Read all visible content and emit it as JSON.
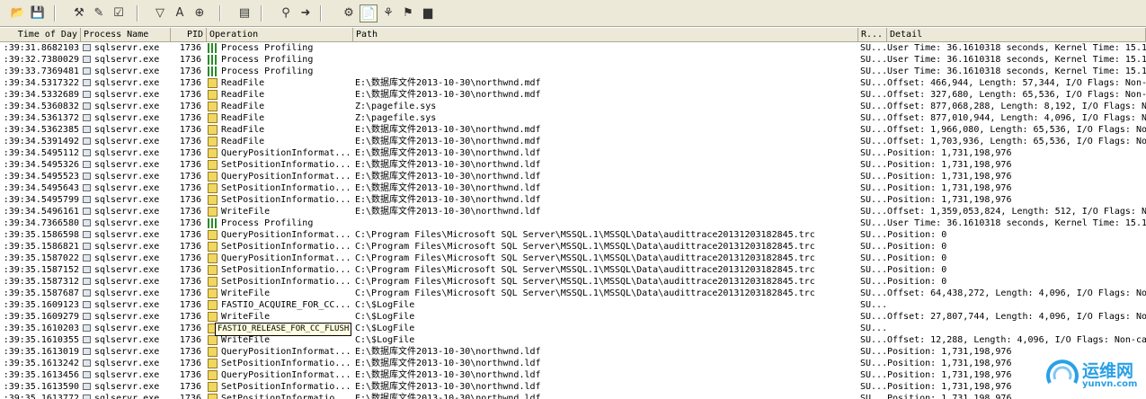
{
  "toolbar": {
    "buttons": [
      {
        "name": "open-icon",
        "glyph": "📂"
      },
      {
        "name": "save-icon",
        "glyph": "💾"
      },
      {
        "name": "autoscroll-icon",
        "glyph": "⚒"
      },
      {
        "name": "clear-icon",
        "glyph": "✎"
      },
      {
        "name": "capture-icon",
        "glyph": "☑"
      },
      {
        "name": "filter-icon",
        "glyph": "▽"
      },
      {
        "name": "highlight-icon",
        "glyph": "A"
      },
      {
        "name": "target-icon",
        "glyph": "⊕"
      },
      {
        "name": "process-tree-icon",
        "glyph": "▤"
      },
      {
        "name": "find-icon",
        "glyph": "⚲"
      },
      {
        "name": "jump-icon",
        "glyph": "➜"
      },
      {
        "name": "registry-activity-icon",
        "glyph": "⚙"
      },
      {
        "name": "file-activity-icon",
        "glyph": "📄"
      },
      {
        "name": "network-activity-icon",
        "glyph": "⚘"
      },
      {
        "name": "process-activity-icon",
        "glyph": "⚑"
      },
      {
        "name": "profiling-activity-icon",
        "glyph": "▆"
      }
    ]
  },
  "columns": {
    "time": "Time of Day",
    "process": "Process Name",
    "pid": "PID",
    "operation": "Operation",
    "path": "Path",
    "result": "R...",
    "detail": "Detail"
  },
  "rows": [
    {
      "time": ":39:31.8682103",
      "process": "sqlservr.exe",
      "pid": "1736",
      "op": "Process Profiling",
      "path": "",
      "result": "SU...",
      "detail": "User Time: 36.1610318 seconds, Kernel Time: 15.1",
      "icon": "prof"
    },
    {
      "time": ":39:32.7380029",
      "process": "sqlservr.exe",
      "pid": "1736",
      "op": "Process Profiling",
      "path": "",
      "result": "SU...",
      "detail": "User Time: 36.1610318 seconds, Kernel Time: 15.1",
      "icon": "prof"
    },
    {
      "time": ":39:33.7369481",
      "process": "sqlservr.exe",
      "pid": "1736",
      "op": "Process Profiling",
      "path": "",
      "result": "SU...",
      "detail": "User Time: 36.1610318 seconds, Kernel Time: 15.1",
      "icon": "prof"
    },
    {
      "time": ":39:34.5317322",
      "process": "sqlservr.exe",
      "pid": "1736",
      "op": "ReadFile",
      "path": "E:\\数据库文件2013-10-30\\northwnd.mdf",
      "result": "SU...",
      "detail": "Offset: 466,944, Length: 57,344, I/O Flags: Non-",
      "icon": "file"
    },
    {
      "time": ":39:34.5332689",
      "process": "sqlservr.exe",
      "pid": "1736",
      "op": "ReadFile",
      "path": "E:\\数据库文件2013-10-30\\northwnd.mdf",
      "result": "SU...",
      "detail": "Offset: 327,680, Length: 65,536, I/O Flags: Non-",
      "icon": "file"
    },
    {
      "time": ":39:34.5360832",
      "process": "sqlservr.exe",
      "pid": "1736",
      "op": "ReadFile",
      "path": "Z:\\pagefile.sys",
      "result": "SU...",
      "detail": "Offset: 877,068,288, Length: 8,192, I/O Flags: N",
      "icon": "file"
    },
    {
      "time": ":39:34.5361372",
      "process": "sqlservr.exe",
      "pid": "1736",
      "op": "ReadFile",
      "path": "Z:\\pagefile.sys",
      "result": "SU...",
      "detail": "Offset: 877,010,944, Length: 4,096, I/O Flags: N",
      "icon": "file"
    },
    {
      "time": ":39:34.5362385",
      "process": "sqlservr.exe",
      "pid": "1736",
      "op": "ReadFile",
      "path": "E:\\数据库文件2013-10-30\\northwnd.mdf",
      "result": "SU...",
      "detail": "Offset: 1,966,080, Length: 65,536, I/O Flags: No",
      "icon": "file"
    },
    {
      "time": ":39:34.5391492",
      "process": "sqlservr.exe",
      "pid": "1736",
      "op": "ReadFile",
      "path": "E:\\数据库文件2013-10-30\\northwnd.mdf",
      "result": "SU...",
      "detail": "Offset: 1,703,936, Length: 65,536, I/O Flags: No",
      "icon": "file"
    },
    {
      "time": ":39:34.5495112",
      "process": "sqlservr.exe",
      "pid": "1736",
      "op": "QueryPositionInformat...",
      "path": "E:\\数据库文件2013-10-30\\northwnd.ldf",
      "result": "SU...",
      "detail": "Position: 1,731,198,976",
      "icon": "file"
    },
    {
      "time": ":39:34.5495326",
      "process": "sqlservr.exe",
      "pid": "1736",
      "op": "SetPositionInformatio...",
      "path": "E:\\数据库文件2013-10-30\\northwnd.ldf",
      "result": "SU...",
      "detail": "Position: 1,731,198,976",
      "icon": "file"
    },
    {
      "time": ":39:34.5495523",
      "process": "sqlservr.exe",
      "pid": "1736",
      "op": "QueryPositionInformat...",
      "path": "E:\\数据库文件2013-10-30\\northwnd.ldf",
      "result": "SU...",
      "detail": "Position: 1,731,198,976",
      "icon": "file"
    },
    {
      "time": ":39:34.5495643",
      "process": "sqlservr.exe",
      "pid": "1736",
      "op": "SetPositionInformatio...",
      "path": "E:\\数据库文件2013-10-30\\northwnd.ldf",
      "result": "SU...",
      "detail": "Position: 1,731,198,976",
      "icon": "file"
    },
    {
      "time": ":39:34.5495799",
      "process": "sqlservr.exe",
      "pid": "1736",
      "op": "SetPositionInformatio...",
      "path": "E:\\数据库文件2013-10-30\\northwnd.ldf",
      "result": "SU...",
      "detail": "Position: 1,731,198,976",
      "icon": "file"
    },
    {
      "time": ":39:34.5496161",
      "process": "sqlservr.exe",
      "pid": "1736",
      "op": "WriteFile",
      "path": "E:\\数据库文件2013-10-30\\northwnd.ldf",
      "result": "SU...",
      "detail": "Offset: 1,359,053,824, Length: 512, I/O Flags: N",
      "icon": "file"
    },
    {
      "time": ":39:34.7366580",
      "process": "sqlservr.exe",
      "pid": "1736",
      "op": "Process Profiling",
      "path": "",
      "result": "SU...",
      "detail": "User Time: 36.1610318 seconds, Kernel Time: 15.1",
      "icon": "prof"
    },
    {
      "time": ":39:35.1586598",
      "process": "sqlservr.exe",
      "pid": "1736",
      "op": "QueryPositionInformat...",
      "path": "C:\\Program Files\\Microsoft SQL Server\\MSSQL.1\\MSSQL\\Data\\audittrace20131203182845.trc",
      "result": "SU...",
      "detail": "Position: 0",
      "icon": "file"
    },
    {
      "time": ":39:35.1586821",
      "process": "sqlservr.exe",
      "pid": "1736",
      "op": "SetPositionInformatio...",
      "path": "C:\\Program Files\\Microsoft SQL Server\\MSSQL.1\\MSSQL\\Data\\audittrace20131203182845.trc",
      "result": "SU...",
      "detail": "Position: 0",
      "icon": "file"
    },
    {
      "time": ":39:35.1587022",
      "process": "sqlservr.exe",
      "pid": "1736",
      "op": "QueryPositionInformat...",
      "path": "C:\\Program Files\\Microsoft SQL Server\\MSSQL.1\\MSSQL\\Data\\audittrace20131203182845.trc",
      "result": "SU...",
      "detail": "Position: 0",
      "icon": "file"
    },
    {
      "time": ":39:35.1587152",
      "process": "sqlservr.exe",
      "pid": "1736",
      "op": "SetPositionInformatio...",
      "path": "C:\\Program Files\\Microsoft SQL Server\\MSSQL.1\\MSSQL\\Data\\audittrace20131203182845.trc",
      "result": "SU...",
      "detail": "Position: 0",
      "icon": "file"
    },
    {
      "time": ":39:35.1587312",
      "process": "sqlservr.exe",
      "pid": "1736",
      "op": "SetPositionInformatio...",
      "path": "C:\\Program Files\\Microsoft SQL Server\\MSSQL.1\\MSSQL\\Data\\audittrace20131203182845.trc",
      "result": "SU...",
      "detail": "Position: 0",
      "icon": "file"
    },
    {
      "time": ":39:35.1587687",
      "process": "sqlservr.exe",
      "pid": "1736",
      "op": "WriteFile",
      "path": "C:\\Program Files\\Microsoft SQL Server\\MSSQL.1\\MSSQL\\Data\\audittrace20131203182845.trc",
      "result": "SU...",
      "detail": "Offset: 64,438,272, Length: 4,096, I/O Flags: No",
      "icon": "file"
    },
    {
      "time": ":39:35.1609123",
      "process": "sqlservr.exe",
      "pid": "1736",
      "op": "FASTIO_ACQUIRE_FOR_CC...",
      "path": "C:\\$LogFile",
      "result": "SU...",
      "detail": "",
      "icon": "file"
    },
    {
      "time": ":39:35.1609279",
      "process": "sqlservr.exe",
      "pid": "1736",
      "op": "WriteFile",
      "path": "C:\\$LogFile",
      "result": "SU...",
      "detail": "Offset: 27,807,744, Length: 4,096, I/O Flags: No",
      "icon": "file"
    },
    {
      "time": ":39:35.1610203",
      "process": "sqlservr.exe",
      "pid": "1736",
      "op": "",
      "path": "C:\\$LogFile",
      "result": "SU...",
      "detail": "",
      "icon": "file"
    },
    {
      "time": ":39:35.1610355",
      "process": "sqlservr.exe",
      "pid": "1736",
      "op": "WriteFile",
      "path": "C:\\$LogFile",
      "result": "SU...",
      "detail": "Offset: 12,288, Length: 4,096, I/O Flags: Non-ca",
      "icon": "file"
    },
    {
      "time": ":39:35.1613019",
      "process": "sqlservr.exe",
      "pid": "1736",
      "op": "QueryPositionInformat...",
      "path": "E:\\数据库文件2013-10-30\\northwnd.ldf",
      "result": "SU...",
      "detail": "Position: 1,731,198,976",
      "icon": "file"
    },
    {
      "time": ":39:35.1613242",
      "process": "sqlservr.exe",
      "pid": "1736",
      "op": "SetPositionInformatio...",
      "path": "E:\\数据库文件2013-10-30\\northwnd.ldf",
      "result": "SU...",
      "detail": "Position: 1,731,198,976",
      "icon": "file"
    },
    {
      "time": ":39:35.1613456",
      "process": "sqlservr.exe",
      "pid": "1736",
      "op": "QueryPositionInformat...",
      "path": "E:\\数据库文件2013-10-30\\northwnd.ldf",
      "result": "SU...",
      "detail": "Position: 1,731,198,976",
      "icon": "file"
    },
    {
      "time": ":39:35.1613590",
      "process": "sqlservr.exe",
      "pid": "1736",
      "op": "SetPositionInformatio...",
      "path": "E:\\数据库文件2013-10-30\\northwnd.ldf",
      "result": "SU...",
      "detail": "Position: 1,731,198,976",
      "icon": "file"
    },
    {
      "time": ":39:35.1613772",
      "process": "sqlservr.exe",
      "pid": "1736",
      "op": "SetPositionInformatio...",
      "path": "E:\\数据库文件2013-10-30\\northwnd.ldf",
      "result": "SU...",
      "detail": "Position: 1,731,198,976",
      "icon": "file"
    }
  ],
  "tooltip": "FASTIO_RELEASE_FOR_CC_FLUSH",
  "watermark": {
    "cn": "运维网",
    "en": "yunvn.com"
  }
}
